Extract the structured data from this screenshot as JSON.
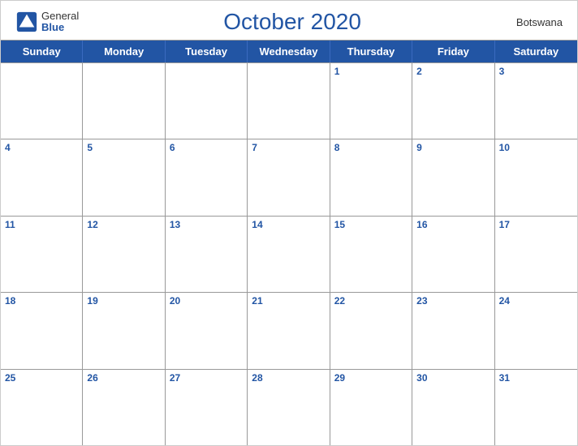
{
  "header": {
    "logo_general": "General",
    "logo_blue": "Blue",
    "month_title": "October 2020",
    "country": "Botswana"
  },
  "days_of_week": [
    "Sunday",
    "Monday",
    "Tuesday",
    "Wednesday",
    "Thursday",
    "Friday",
    "Saturday"
  ],
  "weeks": [
    [
      {
        "num": "",
        "empty": true
      },
      {
        "num": "",
        "empty": true
      },
      {
        "num": "",
        "empty": true
      },
      {
        "num": "",
        "empty": true
      },
      {
        "num": "1",
        "empty": false
      },
      {
        "num": "2",
        "empty": false
      },
      {
        "num": "3",
        "empty": false
      }
    ],
    [
      {
        "num": "4",
        "empty": false
      },
      {
        "num": "5",
        "empty": false
      },
      {
        "num": "6",
        "empty": false
      },
      {
        "num": "7",
        "empty": false
      },
      {
        "num": "8",
        "empty": false
      },
      {
        "num": "9",
        "empty": false
      },
      {
        "num": "10",
        "empty": false
      }
    ],
    [
      {
        "num": "11",
        "empty": false
      },
      {
        "num": "12",
        "empty": false
      },
      {
        "num": "13",
        "empty": false
      },
      {
        "num": "14",
        "empty": false
      },
      {
        "num": "15",
        "empty": false
      },
      {
        "num": "16",
        "empty": false
      },
      {
        "num": "17",
        "empty": false
      }
    ],
    [
      {
        "num": "18",
        "empty": false
      },
      {
        "num": "19",
        "empty": false
      },
      {
        "num": "20",
        "empty": false
      },
      {
        "num": "21",
        "empty": false
      },
      {
        "num": "22",
        "empty": false
      },
      {
        "num": "23",
        "empty": false
      },
      {
        "num": "24",
        "empty": false
      }
    ],
    [
      {
        "num": "25",
        "empty": false
      },
      {
        "num": "26",
        "empty": false
      },
      {
        "num": "27",
        "empty": false
      },
      {
        "num": "28",
        "empty": false
      },
      {
        "num": "29",
        "empty": false
      },
      {
        "num": "30",
        "empty": false
      },
      {
        "num": "31",
        "empty": false
      }
    ]
  ]
}
